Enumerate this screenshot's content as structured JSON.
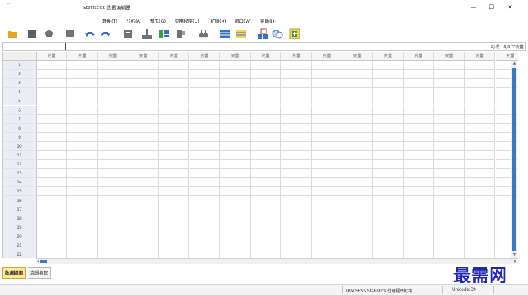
{
  "window": {
    "app_icon_text": "ᵉˢ",
    "title": "Statistics 数据编辑器",
    "minimize_glyph": "—",
    "maximize_glyph": "☐",
    "close_glyph": "✕"
  },
  "menu": [
    "转换(T)",
    "分析(A)",
    "图形(G)",
    "实用程序(U)",
    "扩展(X)",
    "窗口(W)",
    "帮助(H)"
  ],
  "toolbar": {
    "icons": [
      "open-folder",
      "save",
      "print",
      "dialog-recall",
      "undo",
      "redo",
      "goto-case",
      "goto-variable",
      "variables",
      "find",
      "insert-cases",
      "insert-variable",
      "split-file",
      "weight-cases",
      "select-cases",
      "value-labels",
      "use-sets",
      "show-all-variables"
    ],
    "colors": {
      "folder": "#e8a321",
      "disk": "#4c5ea8",
      "gray": "#9c9ea3",
      "arrow": "#2b6cc4",
      "grid": "#3a6fc6",
      "green": "#3b9d3b",
      "yellow": "#f5d15a"
    }
  },
  "cell_editor": {
    "visible_info": "可视：0/0 个变量"
  },
  "grid": {
    "column_header": "变量",
    "columns": [
      "变量",
      "变量",
      "变量",
      "变量",
      "变量",
      "变量",
      "变量",
      "变量",
      "变量",
      "变量",
      "变量",
      "变量",
      "变量",
      "变量",
      "变量",
      "变量"
    ],
    "last_column_partial": "变",
    "rows": [
      "1",
      "2",
      "3",
      "4",
      "5",
      "6",
      "7",
      "8",
      "9",
      "10",
      "11",
      "12",
      "13",
      "14",
      "15",
      "16",
      "17",
      "18",
      "19",
      "20",
      "21",
      "22"
    ],
    "up_arrow": "▲",
    "down_arrow": "▼",
    "left_arrow": "◀",
    "right_arrow": "▶"
  },
  "tabs": {
    "data_view": "数据视图",
    "variable_view": "变量视图"
  },
  "status": {
    "processor": "IBM SPSS Statistics 处理程序就绪",
    "unicode": "Unicode:ON"
  },
  "watermark": "最需网",
  "colors": {
    "accent": "#3a79c4",
    "tab_active": "#ffe79a",
    "row_header": "#eaeef4",
    "watermark": "#1f27b8"
  }
}
